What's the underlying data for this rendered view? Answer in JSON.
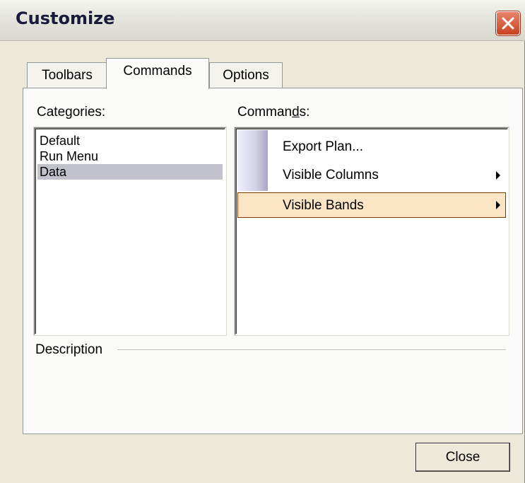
{
  "window": {
    "title": "Customize"
  },
  "tabs": [
    {
      "label": "Toolbars",
      "active": false
    },
    {
      "label": "Commands",
      "active": true
    },
    {
      "label": "Options",
      "active": false
    }
  ],
  "categories": {
    "label_prefix": "Cate",
    "label_underlined": "g",
    "label_suffix": "ories:",
    "items": [
      "Default",
      "Run Menu",
      "Data"
    ],
    "selected": "Data"
  },
  "commands": {
    "label_prefix": "Comman",
    "label_underlined": "d",
    "label_suffix": "s:",
    "items": [
      {
        "label": "Export Plan...",
        "submenu": false
      },
      {
        "label": "Visible Columns",
        "submenu": true
      },
      {
        "label": "Visible Bands",
        "submenu": true,
        "highlighted": true
      }
    ]
  },
  "description": {
    "label": "Description"
  },
  "footer": {
    "close_label": "Close"
  },
  "icons": {
    "close": "close-x-icon",
    "submenu": "submenu-arrow-icon"
  },
  "colors": {
    "dialog_bg": "#ece9d8",
    "selection": "#c1c2cb",
    "hover": "#fce5c5",
    "close_button": "#c9421f"
  }
}
